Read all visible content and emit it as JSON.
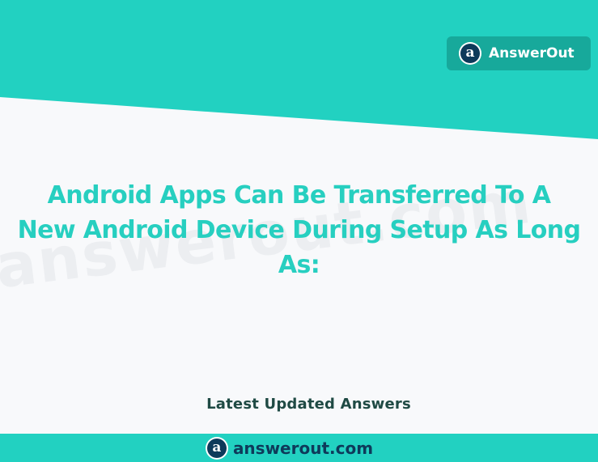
{
  "brand": {
    "name": "AnswerOut",
    "logo_letter": "a",
    "logo_icon": "answerout-logo-icon"
  },
  "watermark": {
    "text": "answerout.com"
  },
  "main": {
    "title_lines": [
      "Android Apps Can Be Transferred To A",
      "New Android Device During Setup As Long",
      "As:"
    ]
  },
  "section": {
    "latest_label": "Latest Updated Answers"
  },
  "footer": {
    "logo_letter": "a",
    "url": "answerout.com"
  },
  "colors": {
    "teal_band": "#22d1c1",
    "badge_bg": "#17a99b",
    "title": "#27cfc0",
    "navy": "#0e3a5a",
    "background": "#f8f9fb"
  }
}
